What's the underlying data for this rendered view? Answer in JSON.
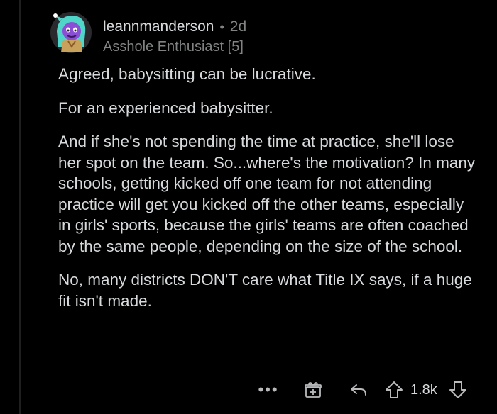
{
  "comment": {
    "username": "leannmanderson",
    "separator": "•",
    "age": "2d",
    "flair": "Asshole Enthusiast [5]",
    "paragraphs": [
      "Agreed, babysitting can be lucrative.",
      "For an experienced babysitter.",
      "And if she's not spending the time at practice, she'll lose her spot on the team. So...where's the motivation? In many schools, getting kicked off one team for not attending practice will get you kicked off the other teams, especially in girls' sports, because the girls' teams are often coached by the same people, depending on the size of the school.",
      "No, many districts DON'T care what Title IX says, if a huge fit isn't made."
    ]
  },
  "actions": {
    "more": "•••",
    "score": "1.8k",
    "icons": [
      "more-icon",
      "award-icon",
      "reply-icon",
      "upvote-icon",
      "downvote-icon"
    ]
  },
  "colors": {
    "background": "#000000",
    "text": "#d7dadc",
    "muted": "#818384",
    "avatar_purple": "#8b4fd6",
    "avatar_hair": "#4fd6c8"
  }
}
